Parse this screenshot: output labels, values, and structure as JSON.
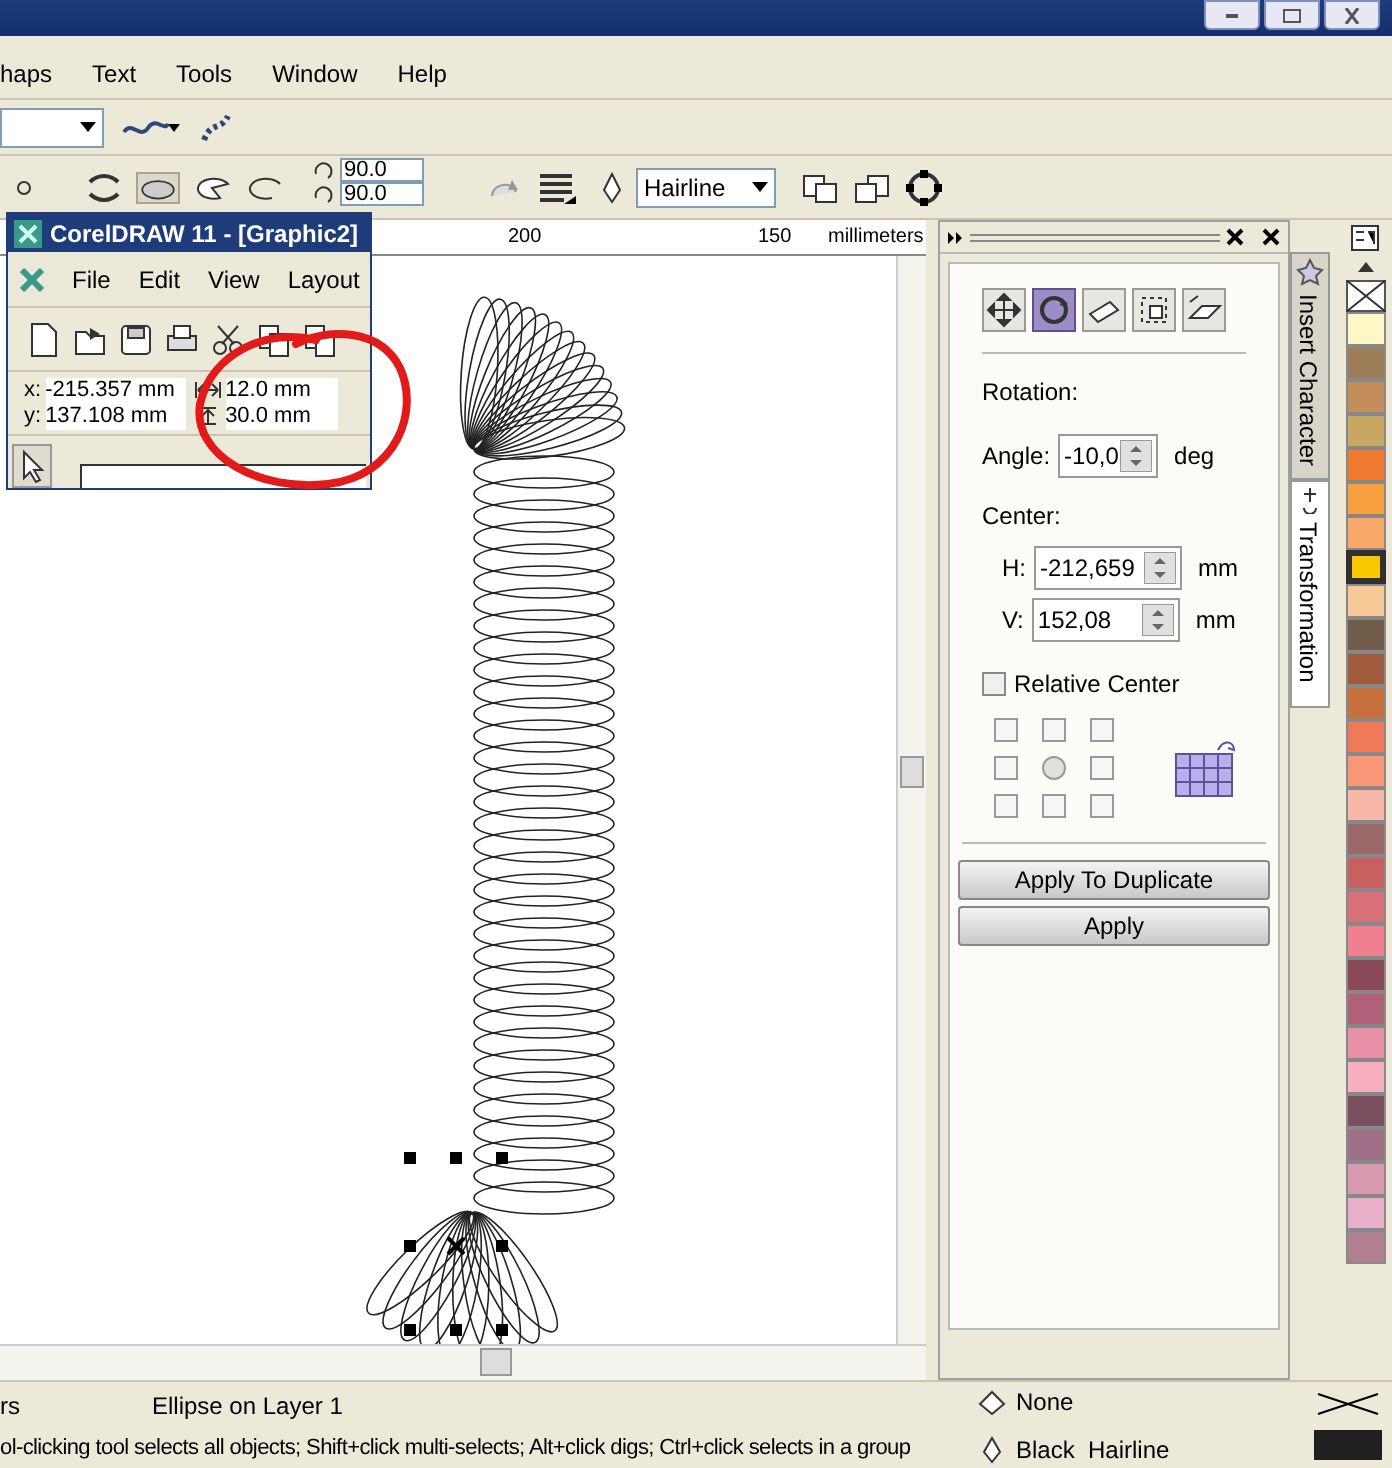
{
  "menu_bar": {
    "items": [
      {
        "label": "haps"
      },
      {
        "label": "Text"
      },
      {
        "label": "Tools"
      },
      {
        "label": "Window"
      },
      {
        "label": "Help"
      }
    ]
  },
  "property_bar": {
    "rotation_fields": [
      "90.0",
      "90.0"
    ],
    "outline_width": "Hairline"
  },
  "document_window": {
    "title": "CorelDRAW 11 - [Graphic2]",
    "menu_items": [
      "File",
      "Edit",
      "View",
      "Layout"
    ],
    "x_label": "x:",
    "y_label": "y:",
    "x": "-215.357 mm",
    "y": "137.108 mm",
    "width": "12.0 mm",
    "height": "30.0 mm"
  },
  "ruler": {
    "labels": [
      "200",
      "150"
    ],
    "unit": "millimeters"
  },
  "docker": {
    "tools": [
      {
        "selected": false
      },
      {
        "selected": true
      },
      {
        "selected": false
      },
      {
        "selected": false
      },
      {
        "selected": false
      }
    ],
    "section": "Rotation:",
    "angle_label": "Angle:",
    "angle": "-10,0",
    "angle_unit": "deg",
    "center_label": "Center:",
    "h_label": "H:",
    "h": "-212,659",
    "h_unit": "mm",
    "v_label": "V:",
    "v": "152,08",
    "v_unit": "mm",
    "relative_center": {
      "label": "Relative Center",
      "checked": false
    },
    "anchors": [
      {
        "selected": false
      },
      {
        "selected": false
      },
      {
        "selected": false
      },
      {
        "selected": false
      },
      {
        "selected": true
      },
      {
        "selected": false
      },
      {
        "selected": false
      },
      {
        "selected": false
      },
      {
        "selected": false
      }
    ],
    "buttons": [
      "Apply To Duplicate",
      "Apply"
    ]
  },
  "side_tabs": [
    {
      "label": "Insert Character",
      "selected": false
    },
    {
      "label": "Transformation",
      "selected": true
    }
  ],
  "palette": [
    {
      "color": "#fff8c4",
      "selected": false
    },
    {
      "color": "#9c7d58",
      "selected": false
    },
    {
      "color": "#c48e5c",
      "selected": false
    },
    {
      "color": "#c8a860",
      "selected": false
    },
    {
      "color": "#f07a30",
      "selected": false
    },
    {
      "color": "#f8a040",
      "selected": false
    },
    {
      "color": "#f8a868",
      "selected": false
    },
    {
      "color": "#f8c800",
      "selected": true
    },
    {
      "color": "#f8c898",
      "selected": false
    },
    {
      "color": "#705c48",
      "selected": false
    },
    {
      "color": "#a05a3c",
      "selected": false
    },
    {
      "color": "#c8703c",
      "selected": false
    },
    {
      "color": "#f07a58",
      "selected": false
    },
    {
      "color": "#f89878",
      "selected": false
    },
    {
      "color": "#f8b8a8",
      "selected": false
    },
    {
      "color": "#9a6868",
      "selected": false
    },
    {
      "color": "#c86060",
      "selected": false
    },
    {
      "color": "#d87078",
      "selected": false
    },
    {
      "color": "#f08090",
      "selected": false
    },
    {
      "color": "#8a4a5a",
      "selected": false
    },
    {
      "color": "#b06078",
      "selected": false
    },
    {
      "color": "#e890a8",
      "selected": false
    },
    {
      "color": "#f8b0c0",
      "selected": false
    },
    {
      "color": "#7a5060",
      "selected": false
    },
    {
      "color": "#a07088",
      "selected": false
    },
    {
      "color": "#d898b0",
      "selected": false
    },
    {
      "color": "#e8b0c8",
      "selected": false
    },
    {
      "color": "#b08090",
      "selected": false
    }
  ],
  "status_bar": {
    "left_top": "rs",
    "selection": "Ellipse on Layer 1",
    "hint": "ol-clicking tool selects all objects; Shift+click multi-selects; Alt+click digs; Ctrl+click selects in a group",
    "fill": "None",
    "outline": "Black  Hairline"
  }
}
